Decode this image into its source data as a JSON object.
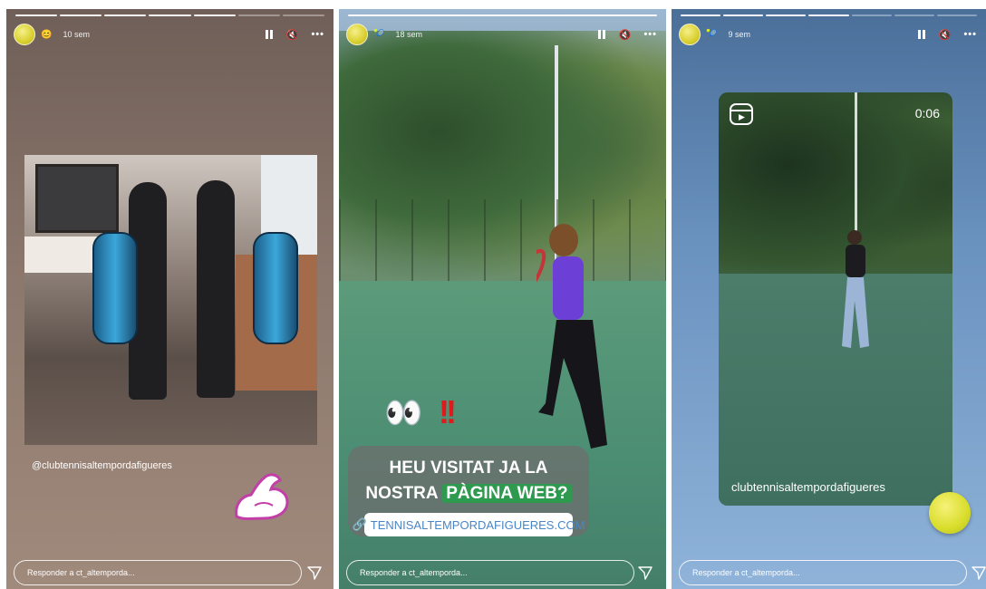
{
  "stories": [
    {
      "time": "10 sem",
      "emoji": "😊",
      "mention": "@clubtennisaltempordafigueres",
      "reply_placeholder": "Responder a ct_altemporda...",
      "progress": {
        "total": 7,
        "done": 5
      }
    },
    {
      "time": "18 sem",
      "emoji": "🎾",
      "eyes": "👀",
      "bangs": "!!",
      "heading_line1": "HEU VISITAT JA LA",
      "heading_line2_a": "NOSTRA",
      "heading_line2_b": "PÀGINA WEB?",
      "link_text": "TENNISALTEMPORDAFIGUERES.COM",
      "reply_placeholder": "Responder a ct_altemporda...",
      "progress": {
        "total": 1,
        "done": 1
      }
    },
    {
      "time": "9 sem",
      "emoji": "🎾",
      "reel_time": "0:06",
      "reel_user": "clubtennisaltempordafigueres",
      "reply_placeholder": "Responder a ct_altemporda...",
      "progress": {
        "total": 7,
        "done": 4
      }
    }
  ],
  "colors": {
    "accent_green": "#2e9a4f",
    "link_blue": "#4a86c5",
    "bang_red": "#e01a1a"
  }
}
